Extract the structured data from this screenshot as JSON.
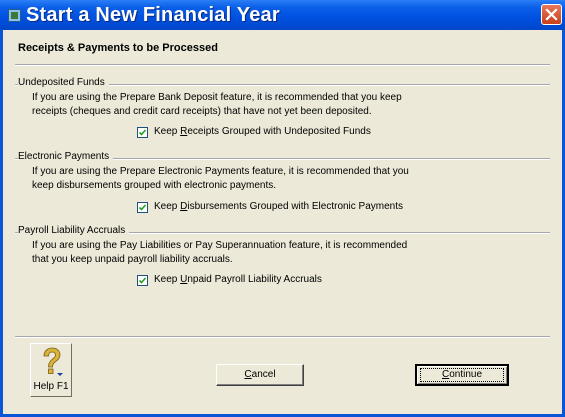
{
  "window": {
    "title": "Start a New Financial Year",
    "title_icon": "app-icon",
    "close_icon": "close-icon"
  },
  "section": {
    "heading": "Receipts & Payments to be Processed"
  },
  "groups": [
    {
      "title": "Undeposited Funds",
      "description_line1": "If you are using the Prepare Bank Deposit feature, it is recommended that you keep",
      "description_line2": "receipts (cheques and credit card receipts) that have not yet been deposited.",
      "checkbox_label_pre": "Keep ",
      "checkbox_label_key": "R",
      "checkbox_label_post": "eceipts Grouped with Undeposited Funds",
      "checked": true
    },
    {
      "title": "Electronic Payments",
      "description_line1": "If you are using the Prepare Electronic Payments feature, it is recommended that you",
      "description_line2": "keep disbursements grouped with electronic payments.",
      "checkbox_label_pre": "Keep ",
      "checkbox_label_key": "D",
      "checkbox_label_post": "isbursements Grouped with Electronic Payments",
      "checked": true
    },
    {
      "title": "Payroll Liability Accruals",
      "description_line1": "If you are using the Pay Liabilities or Pay Superannuation feature, it is recommended",
      "description_line2": "that you keep unpaid payroll liability accruals.",
      "checkbox_label_pre": "Keep ",
      "checkbox_label_key": "U",
      "checkbox_label_post": "npaid Payroll Liability Accruals",
      "checked": true
    }
  ],
  "footer": {
    "help_label": "Help F1",
    "help_icon": "help-question-icon",
    "cancel_key": "C",
    "cancel_rest": "ancel",
    "continue_key": "C",
    "continue_rest": "ontinue"
  },
  "colors": {
    "titlebar": "#0050e0",
    "dialog_bg": "#ece9d8",
    "close_button": "#d65a32"
  }
}
